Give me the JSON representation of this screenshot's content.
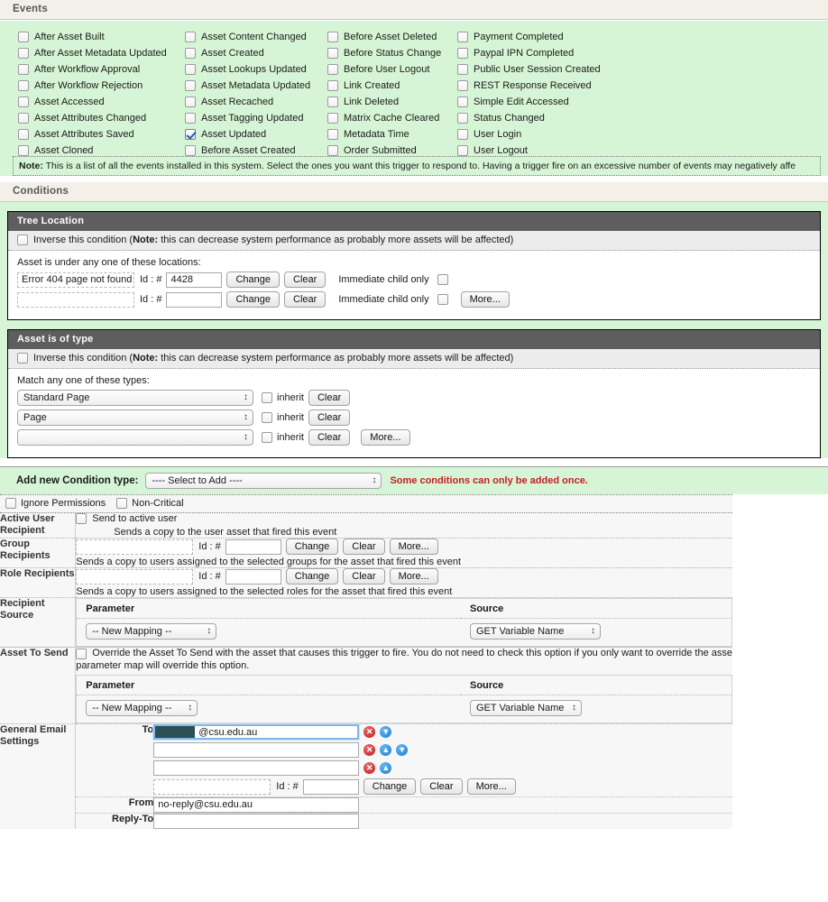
{
  "events": {
    "header": "Events",
    "columns": [
      [
        "After Asset Built",
        "After Asset Metadata Updated",
        "After Workflow Approval",
        "After Workflow Rejection",
        "Asset Accessed",
        "Asset Attributes Changed",
        "Asset Attributes Saved",
        "Asset Cloned"
      ],
      [
        "Asset Content Changed",
        "Asset Created",
        "Asset Lookups Updated",
        "Asset Metadata Updated",
        "Asset Recached",
        "Asset Tagging Updated",
        "Asset Updated",
        "Before Asset Created"
      ],
      [
        "Before Asset Deleted",
        "Before Status Change",
        "Before User Logout",
        "Link Created",
        "Link Deleted",
        "Matrix Cache Cleared",
        "Metadata Time",
        "Order Submitted"
      ],
      [
        "Payment Completed",
        "Paypal IPN Completed",
        "Public User Session Created",
        "REST Response Received",
        "Simple Edit Accessed",
        "Status Changed",
        "User Login",
        "User Logout"
      ]
    ],
    "checked": [
      "Asset Updated"
    ],
    "note_prefix": "Note:",
    "note_text": " This is a list of all the events installed in this system. Select the ones you want this trigger to respond to. Having a trigger fire on an excessive number of events may negatively affe"
  },
  "conditions": {
    "header": "Conditions",
    "inverse_prefix": "Inverse this condition (",
    "inverse_note": "Note:",
    "inverse_suffix": " this can decrease system performance as probably more assets will be affected)",
    "tree_location": {
      "title": "Tree Location",
      "lead": "Asset is under any one of these locations:",
      "rows": [
        {
          "asset": "Error 404 page not found",
          "id_label": "Id : #",
          "id_value": "4428",
          "change": "Change",
          "clear": "Clear",
          "immediate": "Immediate child only",
          "more": ""
        },
        {
          "asset": "",
          "id_label": "Id : #",
          "id_value": "",
          "change": "Change",
          "clear": "Clear",
          "immediate": "Immediate child only",
          "more": "More..."
        }
      ]
    },
    "asset_type": {
      "title": "Asset is of type",
      "lead": "Match any one of these types:",
      "rows": [
        {
          "type": "Standard Page",
          "inherit": "inherit",
          "clear": "Clear",
          "more": ""
        },
        {
          "type": "Page",
          "inherit": "inherit",
          "clear": "Clear",
          "more": ""
        },
        {
          "type": "",
          "inherit": "inherit",
          "clear": "Clear",
          "more": "More..."
        }
      ]
    },
    "add_new": {
      "label": "Add new Condition type:",
      "select_value": "---- Select to Add  ----",
      "warning": "Some conditions can only be added once."
    }
  },
  "permissions": {
    "ignore": "Ignore Permissions",
    "non_critical": "Non-Critical"
  },
  "settings": {
    "active_user": {
      "label": "Active User Recipient",
      "checkbox_label": "Send to active user",
      "hint": "Sends a copy to the user asset that fired this event"
    },
    "group_recipients": {
      "label": "Group Recipients",
      "asset": "",
      "id_label": "Id : #",
      "id_value": "",
      "change": "Change",
      "clear": "Clear",
      "more": "More...",
      "hint": "Sends a copy to users assigned to the selected groups for the asset that fired this event"
    },
    "role_recipients": {
      "label": "Role Recipients",
      "asset": "",
      "id_label": "Id : #",
      "id_value": "",
      "change": "Change",
      "clear": "Clear",
      "more": "More...",
      "hint": "Sends a copy to users assigned to the selected roles for the asset that fired this event"
    },
    "recipient_source": {
      "label": "Recipient Source",
      "col_parameter": "Parameter",
      "col_source": "Source",
      "parameter_value": "-- New Mapping --",
      "source_value": "GET Variable Name"
    },
    "asset_to_send": {
      "label": "Asset To Send",
      "checkbox_label": "Override the Asset To Send with the asset that causes this trigger to fire. You do not need to check this option if you only want to override the asse",
      "checkbox_label_line2": "parameter map will override this option.",
      "col_parameter": "Parameter",
      "col_source": "Source",
      "parameter_value": "-- New Mapping --",
      "source_value": "GET Variable Name"
    },
    "general_email": {
      "label": "General Email Settings",
      "to_label": "To",
      "to_rows": [
        {
          "value": "@csu.edu.au",
          "redacted": true,
          "focused": true,
          "has_up": false,
          "has_down": true
        },
        {
          "value": "",
          "redacted": false,
          "focused": false,
          "has_up": true,
          "has_down": true
        },
        {
          "value": "",
          "redacted": false,
          "focused": false,
          "has_up": true,
          "has_down": false
        }
      ],
      "to_asset": "",
      "to_id_label": "Id : #",
      "to_id_value": "",
      "to_change": "Change",
      "to_clear": "Clear",
      "to_more": "More...",
      "from_label": "From",
      "from_value": "no-reply@csu.edu.au",
      "reply_label": "Reply-To",
      "reply_value": ""
    }
  }
}
